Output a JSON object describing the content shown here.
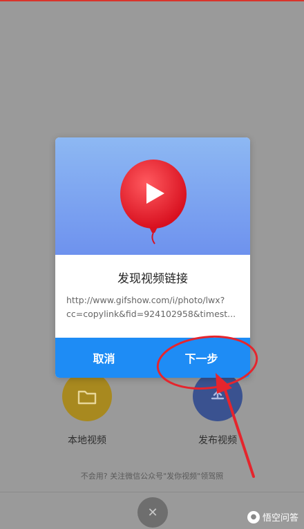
{
  "dialog": {
    "title": "发现视频链接",
    "link_line1": "http://www.gifshow.com/i/photo/lwx?",
    "link_line2": "cc=copylink&fid=924102958&timest...",
    "cancel_label": "取消",
    "next_label": "下一步"
  },
  "background": {
    "local_video_label": "本地视频",
    "publish_video_label": "发布视频",
    "hint": "不会用? 关注微信公众号\"发你视频\"领驾照"
  },
  "close_symbol": "✕",
  "watermark": {
    "text": "悟空问答"
  },
  "colors": {
    "accent": "#1e8cf5",
    "balloon": "#e8192c",
    "annotation": "#e5252d"
  }
}
